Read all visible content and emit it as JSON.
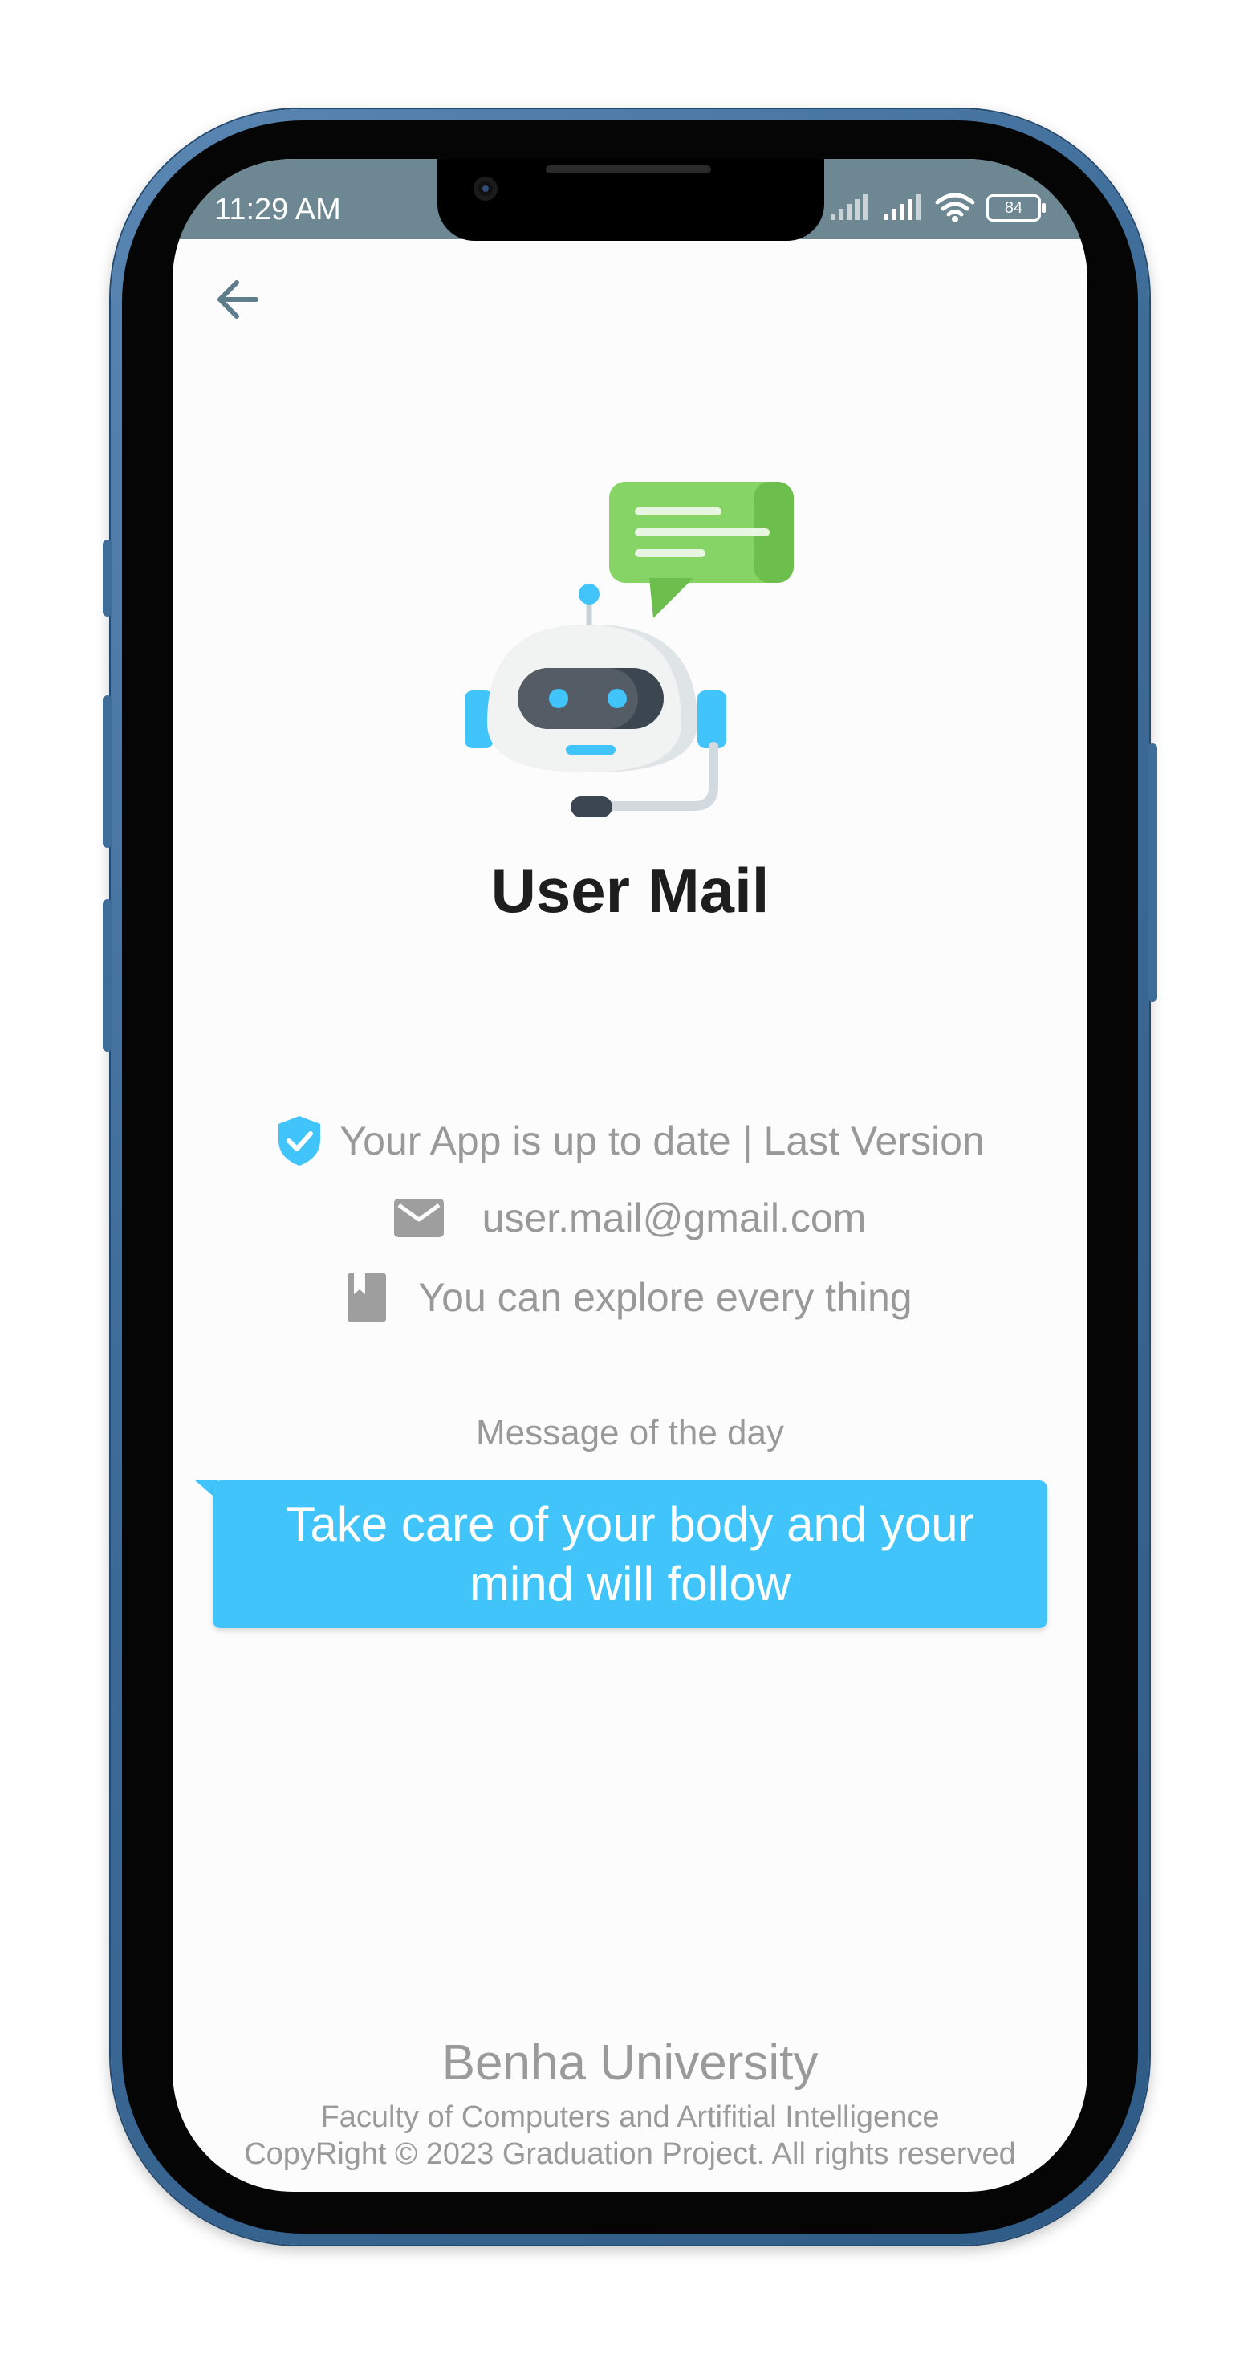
{
  "status_bar": {
    "time": "11:29 AM",
    "battery": "84"
  },
  "header": {
    "back_icon": "arrow-left-icon"
  },
  "profile": {
    "illustration": "robot-chat-icon",
    "title": "User Mail",
    "version_text": "Your App is up to date | Last Version",
    "email": "user.mail@gmail.com",
    "explore_text": "You can explore every thing"
  },
  "message_of_day": {
    "label": "Message of the day",
    "text": "Take care of your body and your mind will follow"
  },
  "footer": {
    "university": "Benha University",
    "faculty": "Faculty of Computers and Artifitial Intelligence",
    "copyright": "CopyRight © 2023 Graduation Project. All rights reserved"
  },
  "colors": {
    "status_bar": "#6d8793",
    "accent": "#40c4fa",
    "title": "#1e1e1e",
    "muted_text": "#999999",
    "bubble_green": "#7ccf5a"
  }
}
